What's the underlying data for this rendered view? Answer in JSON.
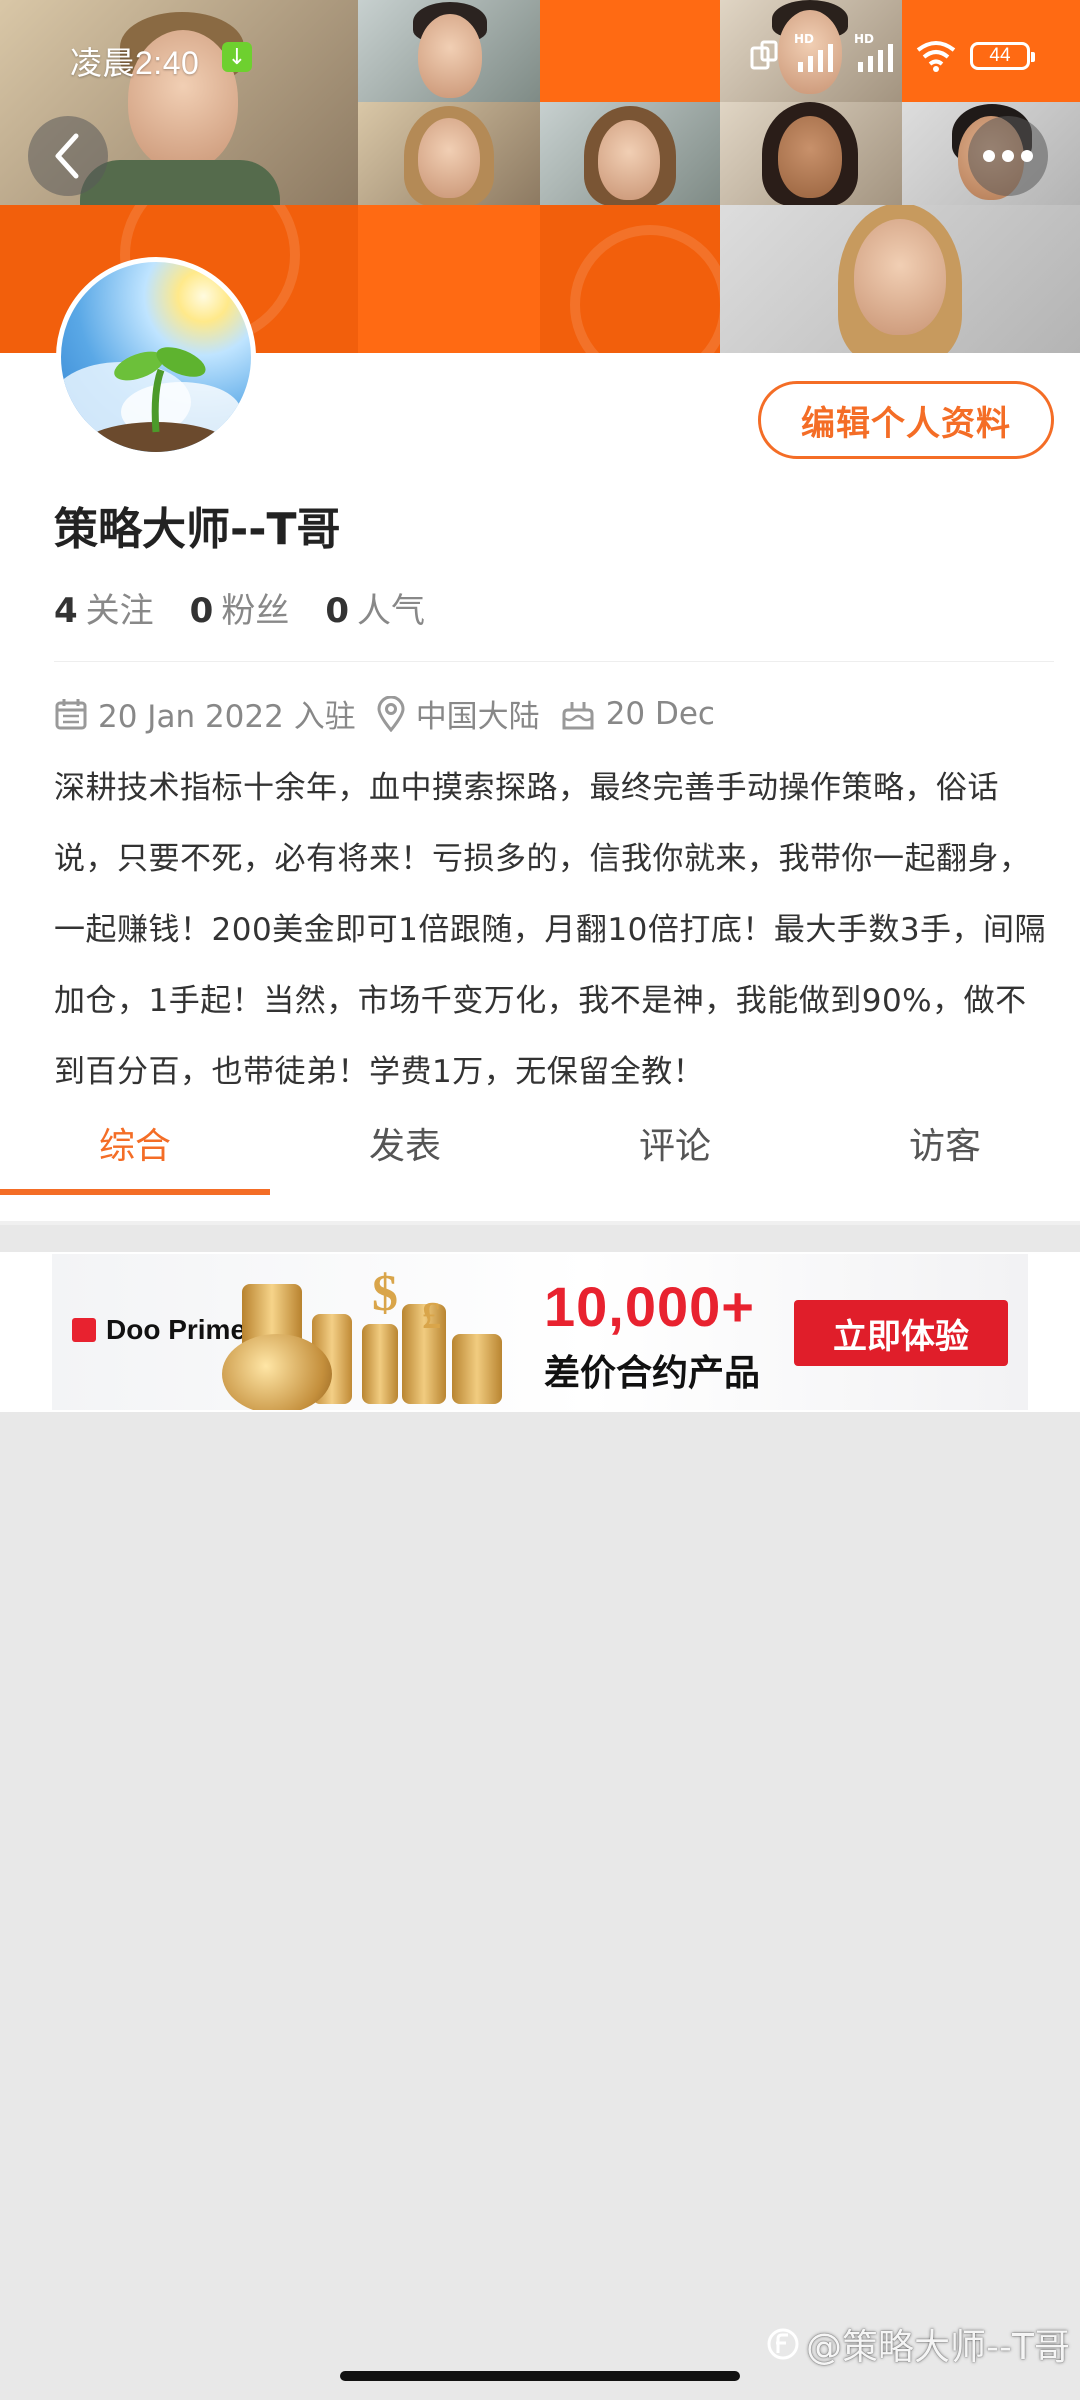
{
  "status_bar": {
    "time": "凌晨2:40",
    "battery": "44",
    "signal_label_1": "HD",
    "signal_label_2": "HD"
  },
  "header": {
    "back_icon": "chevron-left-icon",
    "more_icon": "more-dots-icon"
  },
  "profile": {
    "edit_button": "编辑个人资料",
    "name": "策略大师--T哥",
    "stats": [
      {
        "num": "4",
        "label": "关注"
      },
      {
        "num": "0",
        "label": "粉丝"
      },
      {
        "num": "0",
        "label": "人气"
      }
    ],
    "joined": "20 Jan 2022 入驻",
    "location": "中国大陆",
    "birthday": "20 Dec",
    "bio": "深耕技术指标十余年，血中摸索探路，最终完善手动操作策略，俗话说，只要不死，必有将来！亏损多的，信我你就来，我带你一起翻身，一起赚钱！200美金即可1倍跟随，月翻10倍打底！最大手数3手，间隔加仓，1手起！当然，市场千变万化，我不是神，我能做到90%，做不到百分百，也带徒弟！学费1万，无保留全教！"
  },
  "tabs": [
    {
      "label": "综合",
      "active": true
    },
    {
      "label": "发表",
      "active": false
    },
    {
      "label": "评论",
      "active": false
    },
    {
      "label": "访客",
      "active": false
    }
  ],
  "ad": {
    "brand": "Doo Prime",
    "headline": "10,000+",
    "subline": "差价合约产品",
    "cta": "立即体验"
  },
  "watermark": "@策略大师--T哥",
  "colors": {
    "accent": "#f46d26",
    "cover_orange": "#ff6a13",
    "ad_red": "#e01e2a"
  }
}
